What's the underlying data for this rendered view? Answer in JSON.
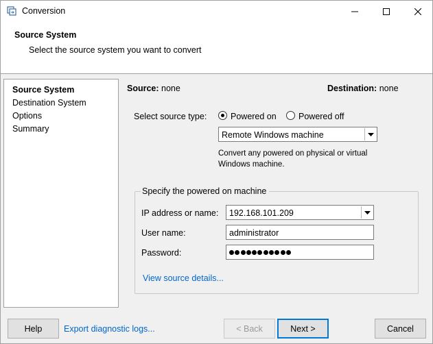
{
  "window": {
    "title": "Conversion"
  },
  "header": {
    "title": "Source System",
    "subtitle": "Select the source system you want to convert"
  },
  "nav": {
    "items": [
      {
        "label": "Source System",
        "active": true
      },
      {
        "label": "Destination System",
        "active": false
      },
      {
        "label": "Options",
        "active": false
      },
      {
        "label": "Summary",
        "active": false
      }
    ]
  },
  "summary": {
    "source_label": "Source:",
    "source_value": "none",
    "destination_label": "Destination:",
    "destination_value": "none"
  },
  "source_type": {
    "label": "Select source type:",
    "powered_on_label": "Powered on",
    "powered_off_label": "Powered off",
    "selected": "Powered on",
    "machine_type_value": "Remote Windows machine",
    "description": "Convert any powered on physical or virtual Windows machine."
  },
  "machine_group": {
    "title": "Specify the powered on machine",
    "ip_label": "IP address or name:",
    "ip_value": "192.168.101.209",
    "username_label": "User name:",
    "username_value": "administrator",
    "password_label": "Password:",
    "password_length": 11,
    "details_link": "View source details..."
  },
  "footer": {
    "help_label": "Help",
    "export_link": "Export diagnostic logs...",
    "back_label": "< Back",
    "next_label": "Next >",
    "cancel_label": "Cancel"
  },
  "colors": {
    "link": "#0066cc",
    "focus_border": "#0078d7",
    "background": "#f0f0f0"
  }
}
